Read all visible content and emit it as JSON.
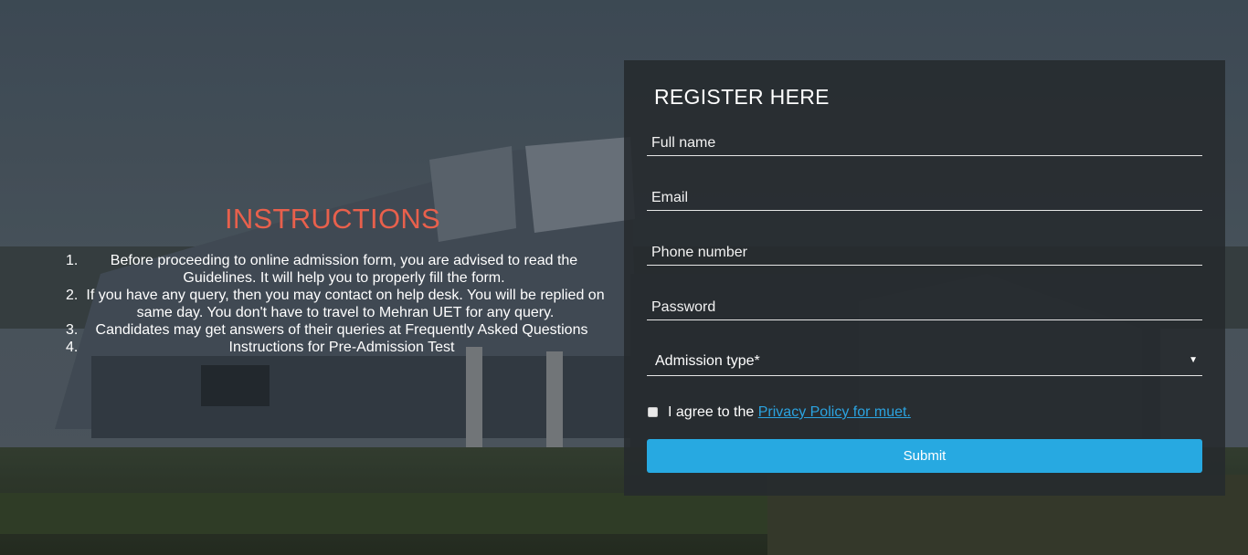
{
  "instructions": {
    "title": "INSTRUCTIONS",
    "items": [
      {
        "num": "1.",
        "text": "Before proceeding to online admission form, you are advised to read the Guidelines. It will help you to properly fill the form."
      },
      {
        "num": "2.",
        "text": "If you have any query, then you may contact on help desk. You will be replied on same day. You don't have to travel to Mehran UET for any query."
      },
      {
        "num": "3.",
        "text": "Candidates may get answers of their queries at Frequently Asked Questions"
      },
      {
        "num": "4.",
        "text": "Instructions for Pre-Admission Test"
      }
    ]
  },
  "register": {
    "title": "REGISTER HERE",
    "fields": {
      "full_name": {
        "placeholder": "Full name",
        "value": ""
      },
      "email": {
        "placeholder": "Email",
        "value": ""
      },
      "phone": {
        "placeholder": "Phone number",
        "value": ""
      },
      "password": {
        "placeholder": "Password",
        "value": ""
      }
    },
    "admission_type": {
      "selected": "Admission type*",
      "caret_icon": "caret-down-icon"
    },
    "agree": {
      "checked": false,
      "text": "I agree to the ",
      "link_text": "Privacy Policy for muet."
    },
    "submit_label": "Submit"
  },
  "colors": {
    "instructions_title": "#e8604c",
    "submit_bg": "#27a9e1",
    "link": "#2ba3e0",
    "card_bg": "#262a2e"
  }
}
